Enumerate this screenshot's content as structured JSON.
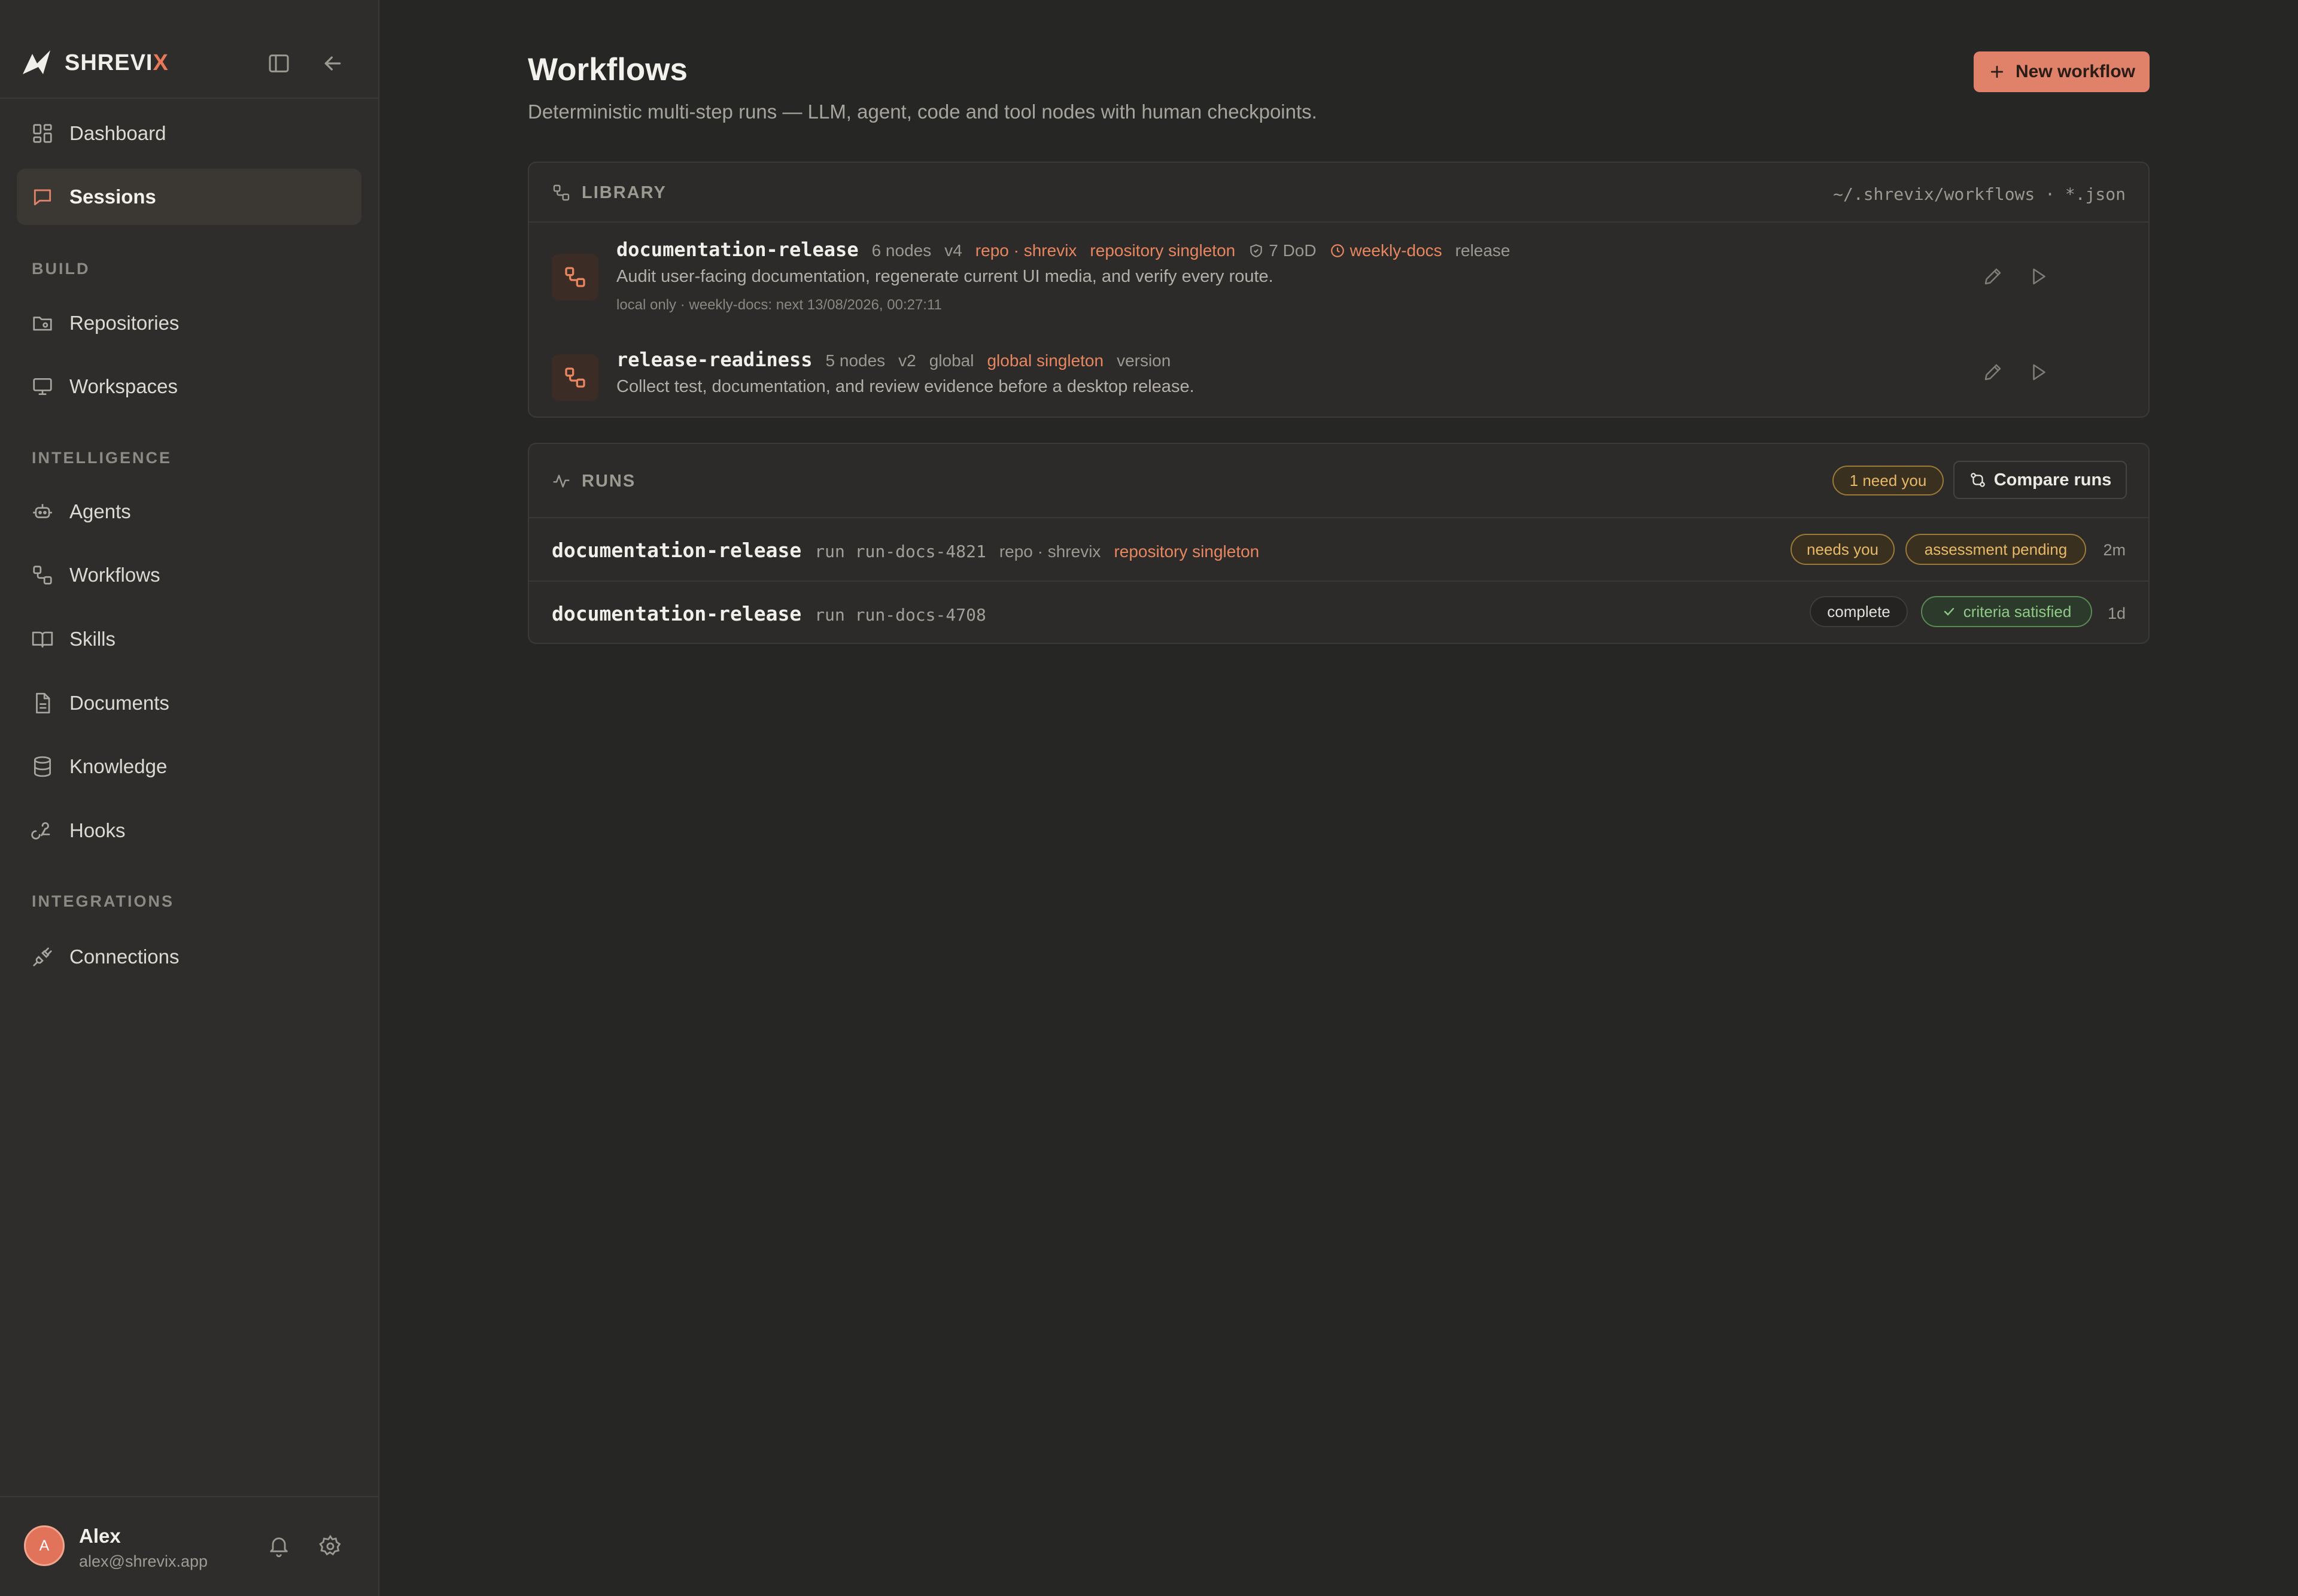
{
  "brand": {
    "name_main": "SHREVI",
    "name_accent": "X"
  },
  "sidebar": {
    "items_top": [
      {
        "label": "Dashboard",
        "icon": "dashboard-icon"
      },
      {
        "label": "Sessions",
        "icon": "chat-icon",
        "active": true
      }
    ],
    "sections": [
      {
        "label": "BUILD",
        "items": [
          {
            "label": "Repositories",
            "icon": "folder-icon"
          },
          {
            "label": "Workspaces",
            "icon": "monitor-icon"
          }
        ]
      },
      {
        "label": "INTELLIGENCE",
        "items": [
          {
            "label": "Agents",
            "icon": "bot-icon"
          },
          {
            "label": "Workflows",
            "icon": "workflow-icon"
          },
          {
            "label": "Skills",
            "icon": "book-icon"
          },
          {
            "label": "Documents",
            "icon": "file-icon"
          },
          {
            "label": "Knowledge",
            "icon": "database-icon"
          },
          {
            "label": "Hooks",
            "icon": "webhook-icon"
          }
        ]
      },
      {
        "label": "INTEGRATIONS",
        "items": [
          {
            "label": "Connections",
            "icon": "plug-icon"
          }
        ]
      }
    ]
  },
  "user": {
    "initial": "A",
    "name": "Alex",
    "email": "alex@shrevix.app"
  },
  "page": {
    "title": "Workflows",
    "subtitle": "Deterministic multi-step runs — LLM, agent, code and tool nodes with human checkpoints.",
    "new_button": "New workflow"
  },
  "library": {
    "title": "LIBRARY",
    "path": "~/.shrevix/workflows · *.json",
    "workflows": [
      {
        "name": "documentation-release",
        "nodes": "6 nodes",
        "version": "v4",
        "scope": "repo · shrevix",
        "singleton": "repository singleton",
        "dod": "7 DoD",
        "schedule": "weekly-docs",
        "tag": "release",
        "description": "Audit user-facing documentation, regenerate current UI media, and verify every route.",
        "sub": "local only · weekly-docs: next 13/08/2026, 00:27:11"
      },
      {
        "name": "release-readiness",
        "nodes": "5 nodes",
        "version": "v2",
        "scope": "global",
        "singleton": "global singleton",
        "tag": "version",
        "description": "Collect test, documentation, and review evidence before a desktop release."
      }
    ]
  },
  "runs": {
    "title": "RUNS",
    "attention_badge": "1 need you",
    "compare_button": "Compare runs",
    "items": [
      {
        "name": "documentation-release",
        "run_id": "run run-docs-4821",
        "scope": "repo · shrevix",
        "singleton": "repository singleton",
        "status": "needs you",
        "assessment": "assessment pending",
        "age": "2m"
      },
      {
        "name": "documentation-release",
        "run_id": "run run-docs-4708",
        "status": "complete",
        "assessment": "criteria satisfied",
        "age": "1d"
      }
    ]
  },
  "colors": {
    "accent": "#e0826a",
    "amber": "#e7b968",
    "green": "#8fcb86",
    "background": "#262624",
    "sidebar": "#2e2d2b"
  }
}
